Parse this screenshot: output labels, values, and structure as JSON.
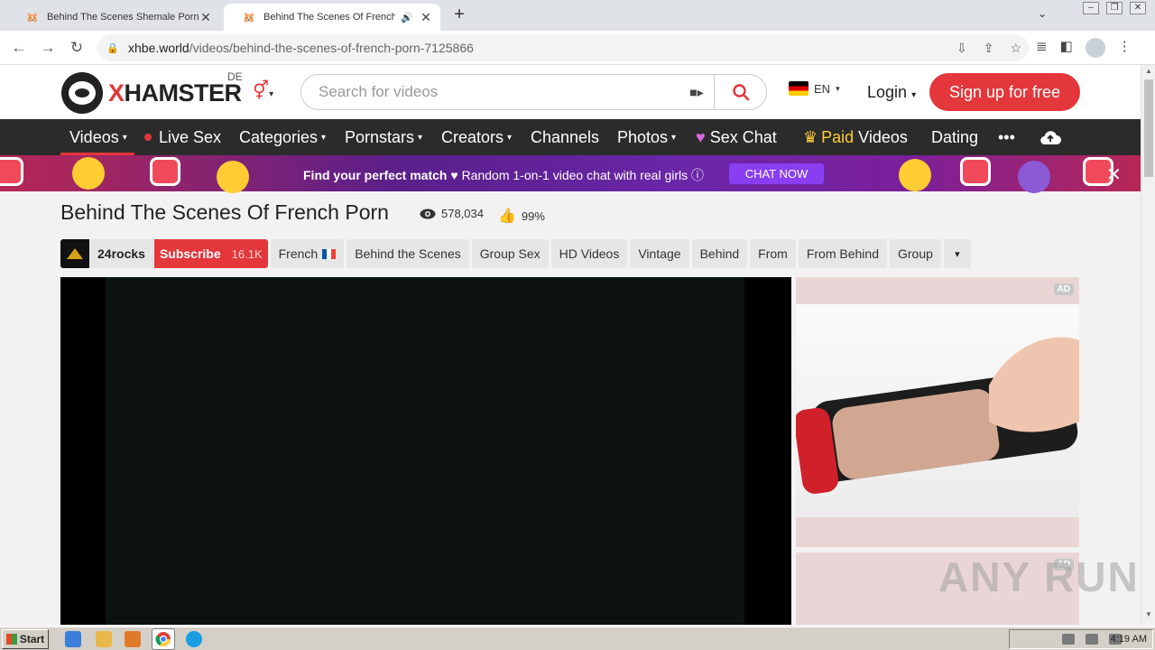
{
  "browser": {
    "tabs": [
      {
        "title": "Behind The Scenes Shemale Porn Vid",
        "active": false
      },
      {
        "title": "Behind The Scenes Of French P",
        "active": true
      }
    ],
    "new_tab": "+",
    "url_host": "xhbe.world",
    "url_path": "/videos/behind-the-scenes-of-french-porn-7125866"
  },
  "site": {
    "logo_x": "X",
    "logo_rest": "HAMSTER",
    "region": "DE",
    "search_placeholder": "Search for videos",
    "language": "EN",
    "login": "Login",
    "signup": "Sign up for free"
  },
  "nav": {
    "videos": "Videos",
    "live_sex": "Live Sex",
    "categories": "Categories",
    "pornstars": "Pornstars",
    "creators": "Creators",
    "channels": "Channels",
    "photos": "Photos",
    "sex_chat": "Sex Chat",
    "paid": "Paid",
    "paid_videos": "Videos",
    "dating": "Dating",
    "more": "•••"
  },
  "banner": {
    "headline": "Find your perfect match",
    "text": "Random 1-on-1 video chat with real girls",
    "cta": "CHAT NOW"
  },
  "video": {
    "title": "Behind The Scenes Of French Porn",
    "views": "578,034",
    "rating": "99%",
    "channel": "24rocks",
    "subscribe": "Subscribe",
    "subscribers": "16.1K",
    "tags": [
      "French",
      "Behind the Scenes",
      "Group Sex",
      "HD Videos",
      "Vintage",
      "Behind",
      "From",
      "From Behind",
      "Group"
    ]
  },
  "ads": {
    "badge": "AD"
  },
  "watermark": "ANY RUN",
  "taskbar": {
    "start": "Start",
    "clock": "4:19 AM"
  },
  "colors": {
    "brand_red": "#e3373b",
    "nav_bg": "#2b2b2b",
    "banner_cta": "#8a3ef2"
  }
}
